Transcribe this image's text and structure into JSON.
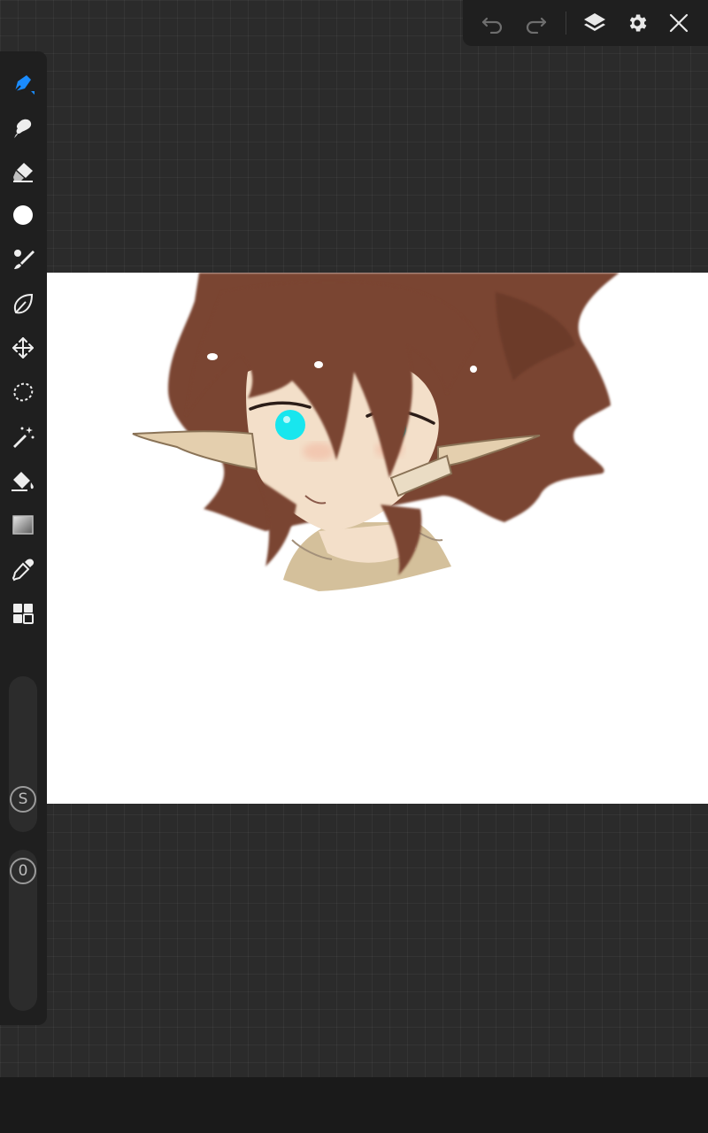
{
  "toolbar": {
    "tools": [
      {
        "name": "pen",
        "icon": "pen-icon",
        "active": true,
        "accent": "#1a8cff"
      },
      {
        "name": "smudge",
        "icon": "smudge-icon"
      },
      {
        "name": "eraser",
        "icon": "eraser-icon"
      },
      {
        "name": "color",
        "icon": "color-swatch",
        "current_color": "#ffffff"
      },
      {
        "name": "brush",
        "icon": "brush-icon"
      },
      {
        "name": "liquify",
        "icon": "leaf-icon"
      },
      {
        "name": "transform",
        "icon": "move-arrows-icon"
      },
      {
        "name": "lasso",
        "icon": "lasso-icon"
      },
      {
        "name": "magic-wand",
        "icon": "magic-wand-icon"
      },
      {
        "name": "fill",
        "icon": "paint-bucket-icon"
      },
      {
        "name": "gradient",
        "icon": "gradient-icon"
      },
      {
        "name": "eyedropper",
        "icon": "eyedropper-icon"
      },
      {
        "name": "more",
        "icon": "grid-icon"
      }
    ],
    "size_slider": {
      "badge": "S",
      "icon": "size-icon"
    },
    "opacity_slider": {
      "badge": "0",
      "icon": "opacity-icon"
    }
  },
  "topbar": {
    "undo": {
      "icon": "undo-icon"
    },
    "redo": {
      "icon": "redo-icon"
    },
    "layers": {
      "icon": "layers-icon"
    },
    "settings": {
      "icon": "gear-icon"
    },
    "close": {
      "icon": "close-icon"
    }
  },
  "canvas": {
    "artwork": "anime-elf-character-sketch",
    "colors": {
      "hair": "#7a4430",
      "skin": "#f3dfc9",
      "eyes": "#18e6ee",
      "background": "#ffffff"
    }
  }
}
